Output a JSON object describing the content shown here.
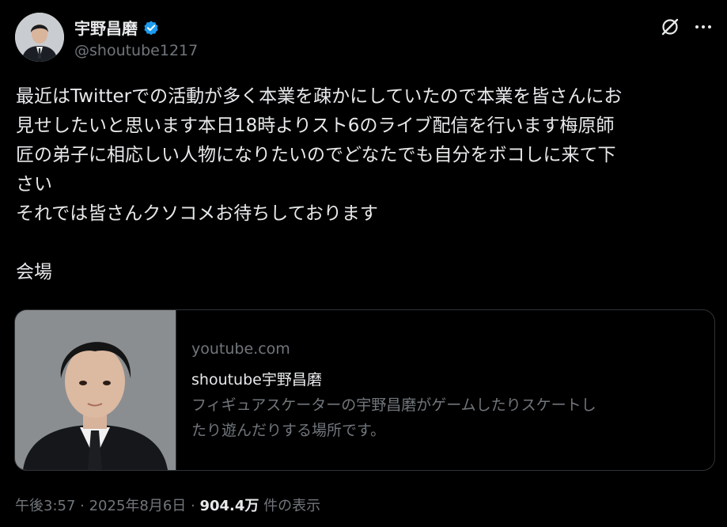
{
  "author": {
    "name": "宇野昌磨",
    "handle": "@shoutube1217",
    "avatar_icon": "person-avatar"
  },
  "actions": {
    "grok_icon": "grok-icon",
    "more_icon": "more-horizontal-icon"
  },
  "tweet": {
    "lines": [
      "最近はTwitterでの活動が多く本業を疎かにしていたので本業を皆さんにお",
      "見せしたいと思います本日18時よりスト6のライブ配信を行います梅原師",
      "匠の弟子に相応しい人物になりたいのでどなたでも自分をボコしに来て下",
      "さい",
      "それでは皆さんクソコメお待ちしております",
      "",
      "会場"
    ]
  },
  "card": {
    "domain": "youtube.com",
    "title": "shoutube宇野昌磨",
    "description_lines": [
      "フィギュアスケーターの宇野昌磨がゲームしたりスケートし",
      "たり遊んだりする場所です。"
    ]
  },
  "meta": {
    "time": "午後3:57",
    "separator": " · ",
    "date": "2025年8月6日",
    "views_count": "904.4万",
    "views_label": " 件の表示"
  },
  "colors": {
    "background": "#000000",
    "text": "#e7e9ea",
    "secondary": "#71767b",
    "verified": "#1d9bf0",
    "border": "#2f3336"
  }
}
